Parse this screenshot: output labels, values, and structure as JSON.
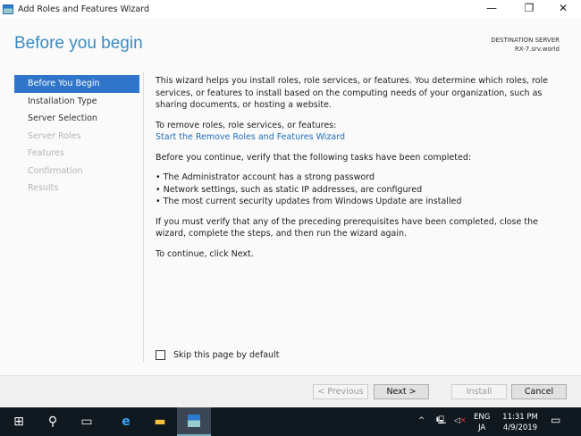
{
  "window": {
    "title": "Add Roles and Features Wizard",
    "minimize": "—",
    "restore": "❐",
    "close": "✕"
  },
  "header": {
    "title": "Before you begin",
    "dest_label": "DESTINATION SERVER",
    "dest_server": "RX-7.srv.world"
  },
  "nav": [
    {
      "label": "Before You Begin",
      "state": "selected"
    },
    {
      "label": "Installation Type",
      "state": "enabled"
    },
    {
      "label": "Server Selection",
      "state": "enabled"
    },
    {
      "label": "Server Roles",
      "state": "disabled"
    },
    {
      "label": "Features",
      "state": "disabled"
    },
    {
      "label": "Confirmation",
      "state": "disabled"
    },
    {
      "label": "Results",
      "state": "disabled"
    }
  ],
  "content": {
    "intro": "This wizard helps you install roles, role services, or features. You determine which roles, role services, or features to install based on the computing needs of your organization, such as sharing documents, or hosting a website.",
    "remove_label": "To remove roles, role services, or features:",
    "remove_link": "Start the Remove Roles and Features Wizard",
    "verify": "Before you continue, verify that the following tasks have been completed:",
    "bullets": [
      "The Administrator account has a strong password",
      "Network settings, such as static IP addresses, are configured",
      "The most current security updates from Windows Update are installed"
    ],
    "prereq": "If you must verify that any of the preceding prerequisites have been completed, close the wizard, complete the steps, and then run the wizard again.",
    "continue": "To continue, click Next."
  },
  "skip_label": "Skip this page by default",
  "buttons": {
    "previous": "< Previous",
    "next": "Next >",
    "install": "Install",
    "cancel": "Cancel"
  },
  "taskbar": {
    "lang1": "ENG",
    "lang2": "JA",
    "time": "11:31 PM",
    "date": "4/9/2019"
  }
}
